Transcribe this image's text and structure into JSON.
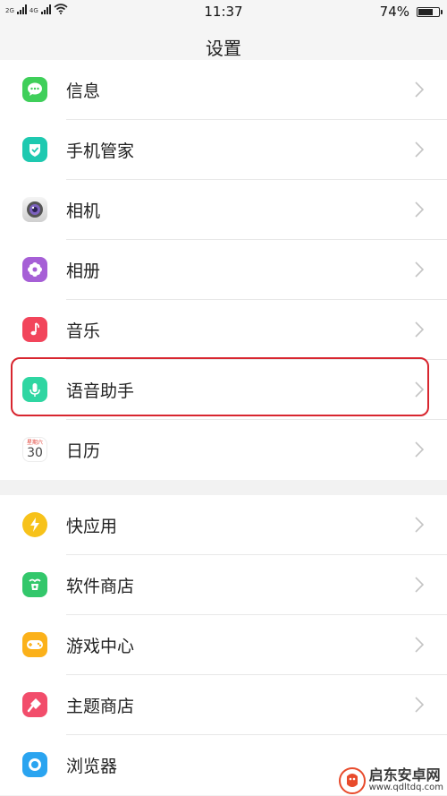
{
  "status_bar": {
    "network_1": "2G",
    "network_2": "4G",
    "time": "11:37",
    "battery_text": "74%",
    "battery_level": 0.74
  },
  "header": {
    "title": "设置"
  },
  "groups": [
    {
      "items": [
        {
          "label": "信息",
          "icon": "message-icon",
          "color": "#3fcf5a"
        },
        {
          "label": "手机管家",
          "icon": "shield-icon",
          "color": "#1ec9b0"
        },
        {
          "label": "相机",
          "icon": "camera-icon",
          "color": "#9b9b9b"
        },
        {
          "label": "相册",
          "icon": "album-icon",
          "color": "#a65fd6"
        },
        {
          "label": "音乐",
          "icon": "music-icon",
          "color": "#f2455b"
        },
        {
          "label": "语音助手",
          "icon": "microphone-icon",
          "color": "#2fd6a2",
          "highlighted": true
        },
        {
          "label": "日历",
          "icon": "calendar-icon",
          "calendar_weekday": "星期六",
          "calendar_day": "30",
          "calendar_accent": "#e2463c"
        }
      ]
    },
    {
      "items": [
        {
          "label": "快应用",
          "icon": "lightning-icon",
          "color": "#f7c21a"
        },
        {
          "label": "软件商店",
          "icon": "store-icon",
          "color": "#33c76b"
        },
        {
          "label": "游戏中心",
          "icon": "gamepad-icon",
          "color": "#fbb11a"
        },
        {
          "label": "主题商店",
          "icon": "theme-brush-icon",
          "color": "#f24d6b"
        },
        {
          "label": "浏览器",
          "icon": "browser-icon",
          "color": "#2aa4f0"
        }
      ]
    }
  ],
  "watermark": {
    "name": "启东安卓网",
    "url": "www.qdltdq.com",
    "logo_color": "#e84b2c"
  }
}
